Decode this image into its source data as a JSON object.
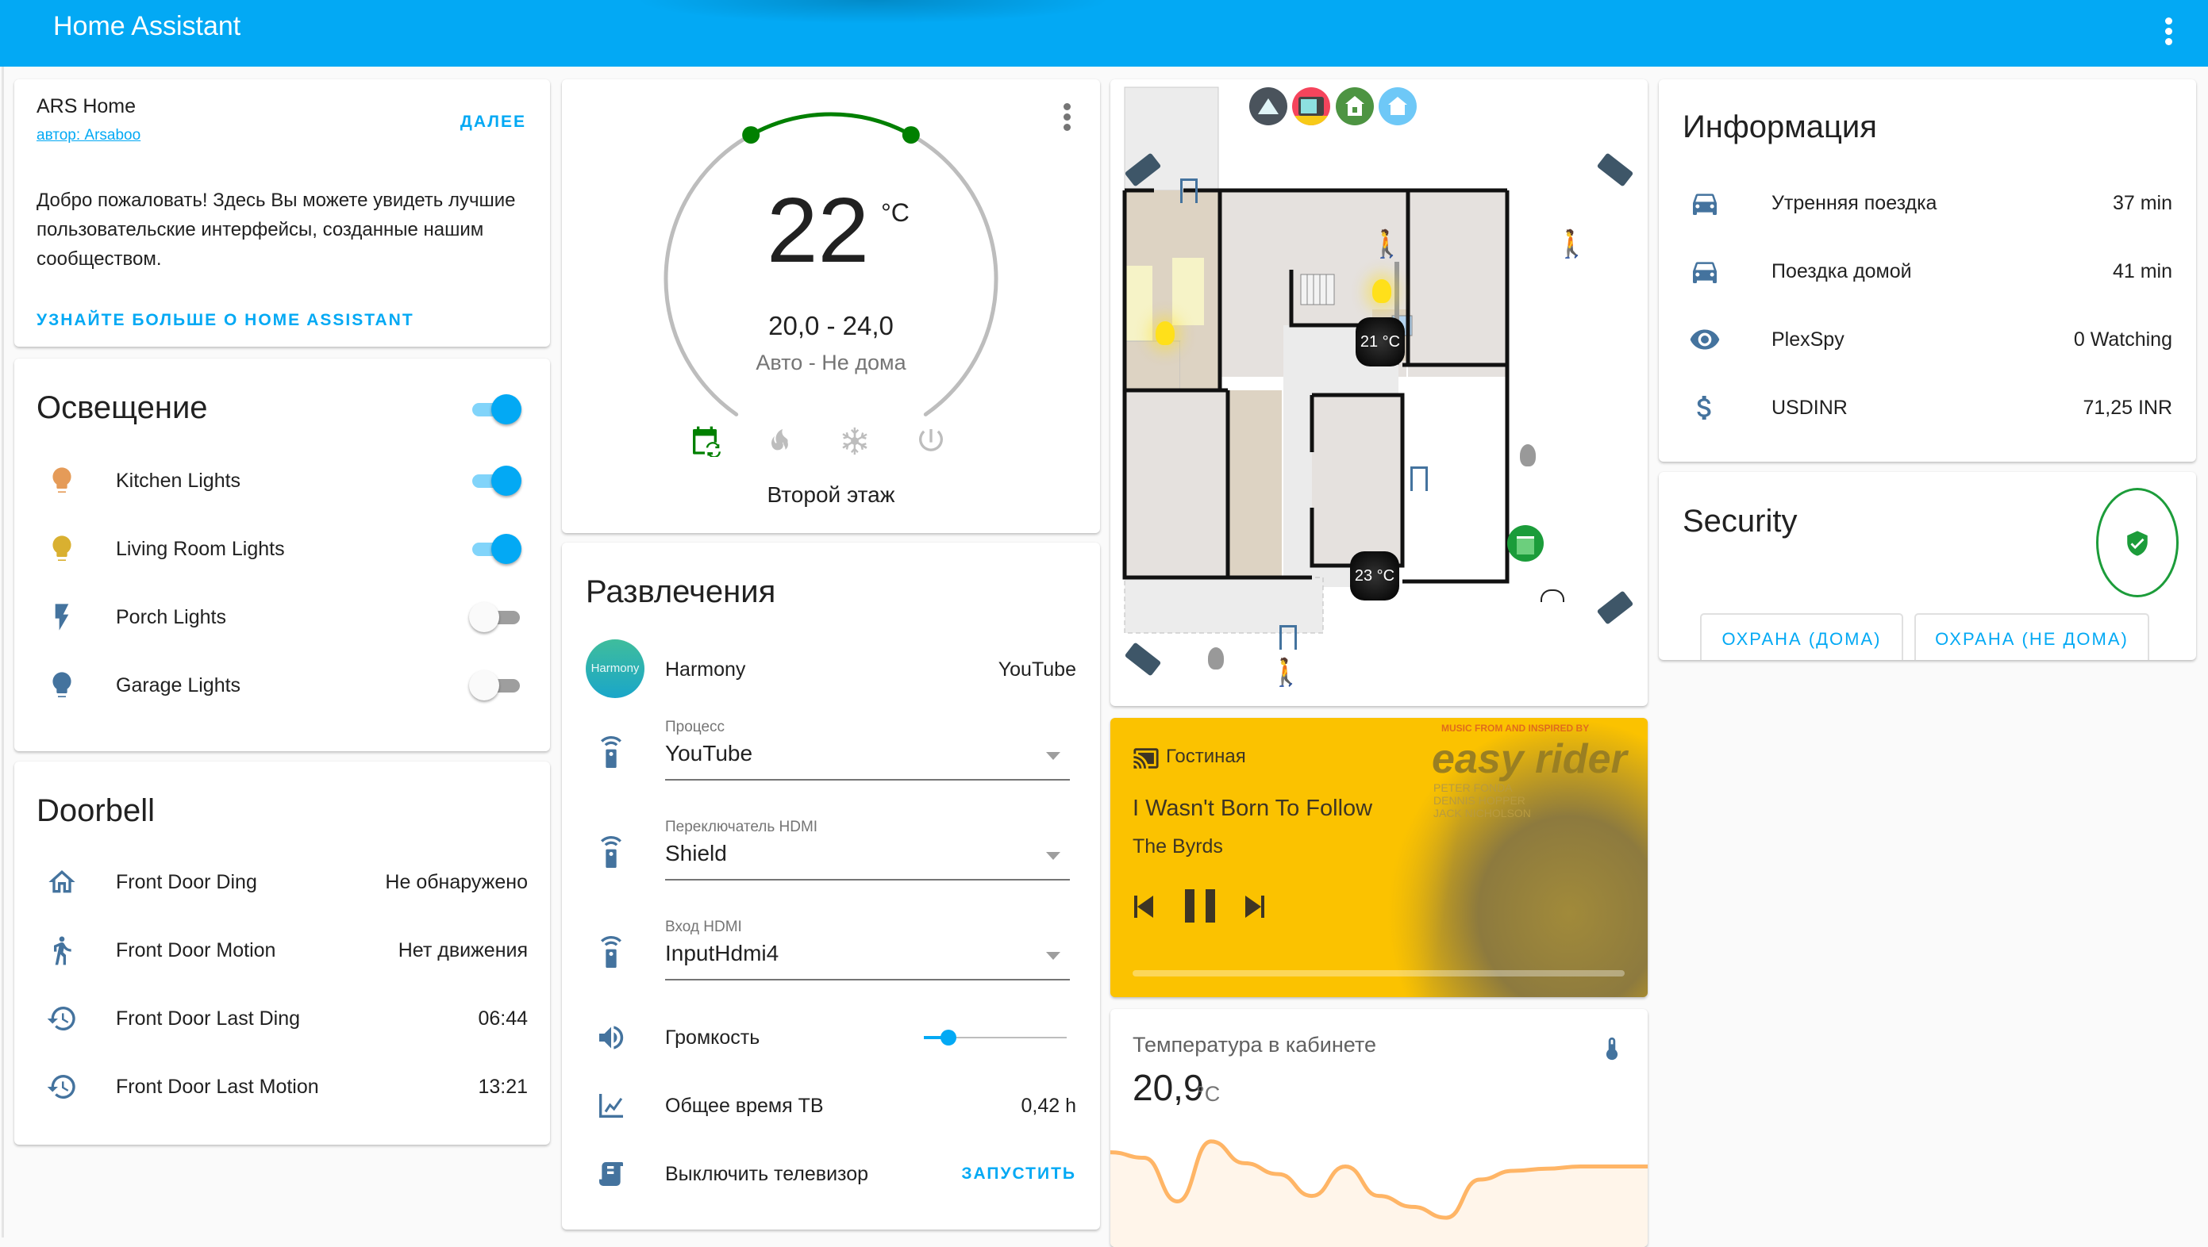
{
  "header": {
    "title": "Home Assistant",
    "menu_icon": "dots-vertical-icon"
  },
  "colors": {
    "accent": "#03a9f4",
    "icon_blue": "#44739e",
    "green": "#008000",
    "media_bg": "#fbc200",
    "graph": "#ffb566"
  },
  "welcome": {
    "title": "ARS Home",
    "author": "автор: Arsaboo",
    "next_label": "ДАЛЕЕ",
    "text": "Добро пожаловать! Здесь Вы можете увидеть лучшие пользовательские интерфейсы, созданные нашим сообществом.",
    "learn_more": "УЗНАЙТЕ БОЛЬШЕ О HOME ASSISTANT"
  },
  "lights": {
    "title": "Освещение",
    "master_on": true,
    "items": [
      {
        "name": "Kitchen Lights",
        "icon": "lightbulb-icon",
        "color": "#e59b58",
        "on": true
      },
      {
        "name": "Living Room Lights",
        "icon": "lightbulb-icon",
        "color": "#d9b030",
        "on": true
      },
      {
        "name": "Porch Lights",
        "icon": "flash-icon",
        "color": "#44739e",
        "on": false
      },
      {
        "name": "Garage Lights",
        "icon": "lightbulb-icon",
        "color": "#44739e",
        "on": false
      }
    ]
  },
  "doorbell": {
    "title": "Doorbell",
    "items": [
      {
        "name": "Front Door Ding",
        "icon": "home-outline-icon",
        "value": "Не обнаружено"
      },
      {
        "name": "Front Door Motion",
        "icon": "walk-icon",
        "value": "Нет движения"
      },
      {
        "name": "Front Door Last Ding",
        "icon": "history-icon",
        "value": "06:44"
      },
      {
        "name": "Front Door Last Motion",
        "icon": "history-icon",
        "value": "13:21"
      }
    ]
  },
  "thermostat": {
    "current": "22",
    "unit": "°C",
    "range": "20,0 - 24,0",
    "mode": "Авто - Не дома",
    "name": "Второй этаж",
    "target_low": 20.0,
    "target_high": 24.0,
    "modes": [
      {
        "name": "auto",
        "icon": "calendar-sync-icon",
        "active": true
      },
      {
        "name": "heat",
        "icon": "fire-icon",
        "active": false
      },
      {
        "name": "cool",
        "icon": "snowflake-icon",
        "active": false
      },
      {
        "name": "off",
        "icon": "power-icon",
        "active": false
      }
    ]
  },
  "entertainment": {
    "title": "Развлечения",
    "harmony": {
      "avatar_text": "Harmony",
      "name": "Harmony",
      "value": "YouTube"
    },
    "selects": [
      {
        "label": "Процесс",
        "value": "YouTube"
      },
      {
        "label": "Переключатель HDMI",
        "value": "Shield"
      },
      {
        "label": "Вход HDMI",
        "value": "InputHdmi4"
      }
    ],
    "volume": {
      "label": "Громкость",
      "value": 0.17
    },
    "tv_time": {
      "label": "Общее время ТВ",
      "value": "0,42 h"
    },
    "tv_off": {
      "label": "Выключить телевизор",
      "action": "ЗАПУСТИТЬ"
    }
  },
  "floorplan": {
    "top_icons": [
      "alexa-icon",
      "tv-icon",
      "lock-open-home-icon",
      "home-wifi-icon"
    ],
    "thermostats": [
      {
        "label": "21 °C"
      },
      {
        "label": "23 °C"
      }
    ]
  },
  "media": {
    "source": "Гостиная",
    "track": "I Wasn't Born To Follow",
    "artist": "The Byrds",
    "album_art_title": "easy rider",
    "album_art_top": "MUSIC FROM AND INSPIRED BY",
    "album_art_cast": [
      "PETER FONDA",
      "DENNIS HOPPER",
      "JACK NICHOLSON"
    ],
    "progress": 0.0
  },
  "temperature": {
    "title": "Температура в кабинете",
    "value": "20,9",
    "unit": "°C",
    "series": [
      20.95,
      20.9,
      20.5,
      21.05,
      20.85,
      20.75,
      20.55,
      20.82,
      20.55,
      20.45,
      20.35,
      20.7,
      20.78,
      20.8,
      20.82,
      20.82,
      20.82
    ]
  },
  "info": {
    "title": "Информация",
    "items": [
      {
        "name": "Утренняя поездка",
        "icon": "car-icon",
        "value": "37 min"
      },
      {
        "name": "Поездка домой",
        "icon": "car-icon",
        "value": "41 min"
      },
      {
        "name": "PlexSpy",
        "icon": "eye-icon",
        "value": "0 Watching"
      },
      {
        "name": "USDINR",
        "icon": "currency-usd-icon",
        "value": "71,25 INR"
      }
    ]
  },
  "security": {
    "title": "Security",
    "state_icon": "shield-check-icon",
    "buttons": [
      "ОХРАНА (ДОМА)",
      "ОХРАНА (НЕ ДОМА)"
    ]
  }
}
